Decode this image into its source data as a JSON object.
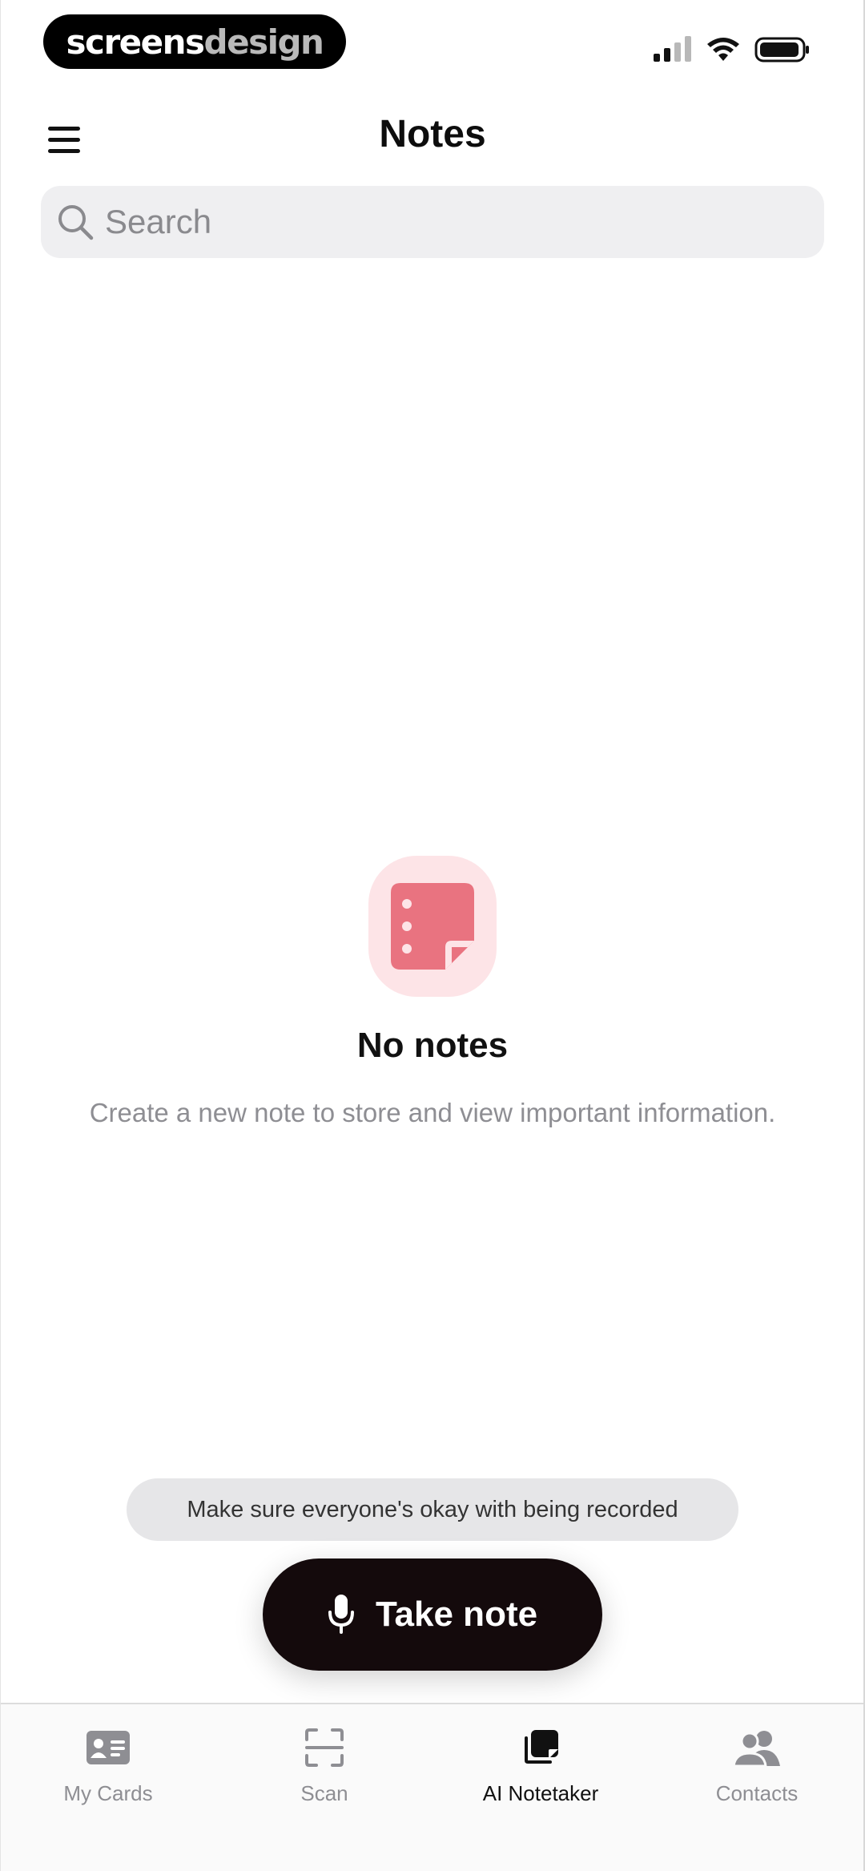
{
  "status_bar": {
    "brand_primary": "screens",
    "brand_secondary": "design"
  },
  "header": {
    "title": "Notes",
    "menu_icon": "hamburger-menu-icon"
  },
  "search": {
    "placeholder": "Search",
    "value": "",
    "icon": "search-icon"
  },
  "empty_state": {
    "icon": "note-icon",
    "title": "No notes",
    "description": "Create a new note to store and view important information.",
    "icon_color": "#e97380",
    "icon_bg": "#fde4e7"
  },
  "consent_banner": {
    "text": "Make sure everyone's okay with being recorded"
  },
  "fab": {
    "label": "Take note",
    "icon": "microphone-icon",
    "color": "#140a0c"
  },
  "tab_bar": {
    "active": "AI Notetaker",
    "items": [
      {
        "label": "My Cards",
        "icon": "id-card-icon"
      },
      {
        "label": "Scan",
        "icon": "scan-frame-icon"
      },
      {
        "label": "AI Notetaker",
        "icon": "notes-stack-icon"
      },
      {
        "label": "Contacts",
        "icon": "contacts-icon"
      }
    ]
  }
}
